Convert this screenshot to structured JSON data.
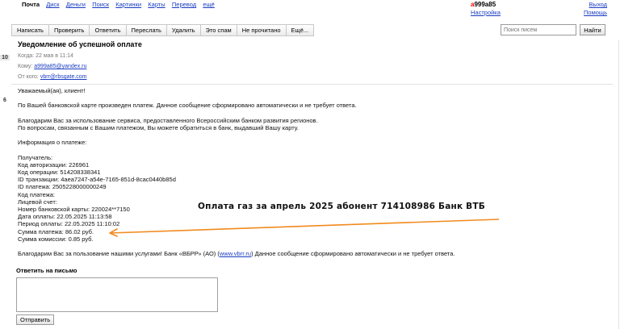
{
  "topnav": {
    "links": [
      "Почта",
      "Диск",
      "Деньги",
      "Поиск",
      "Картинки",
      "Карты",
      "Перевод",
      "ещё"
    ],
    "user_login_first": "a",
    "user_login_rest": "999a85",
    "settings": "Настройка",
    "logout": "Выход",
    "help": "Помощь"
  },
  "leftrail": {
    "date1": "10",
    "date2": "6"
  },
  "toolbar": {
    "buttons": [
      "Написать",
      "Проверить",
      "Ответить",
      "Переслать",
      "Удалить",
      "Это спам",
      "Не прочитано",
      "Ещё..."
    ],
    "search_placeholder": "Поиск писем",
    "search_button": "Найти"
  },
  "message": {
    "subject": "Уведомление об успешной оплате",
    "date_label": "Когда:",
    "date_value": "22 мая в 11:14",
    "to_label": "Кому:",
    "to_value": "a999a85@yandex.ru",
    "from_label": "От кого:",
    "from_value": "vbrr@rbsgate.com"
  },
  "body": {
    "greeting": "Уважаемый(ая), клиент!",
    "p1": "По Вашей банковской карте произведен платеж. Данное сообщение сформировано автоматически и не требует ответа.",
    "p2a": "Благодарим Вас за использование сервиса, предоставленного Всероссийским банком развития регионов.",
    "p2b": "По вопросам, связанным с Вашим платежом, Вы можете обратиться в банк, выдавший Вашу карту.",
    "info_title": "Информация о платеже:",
    "details": [
      "Получатель:",
      "Код авторизации: 226961",
      "Код операции: 514208338341",
      "ID транзакции: 4aea7247-a54e-7165-851d-8cac0440b85d",
      "ID платежа: 2505228000000249",
      "Код платежа:",
      "Лицевой счет:",
      "Номер банковской карты: 220024**7150",
      "Дата оплаты: 22.05.2025 11:13:58",
      "Период оплаты: 22.05.2025 11:10:02",
      "Сумма платежа: 86.02 руб.",
      "Сумма комиссии: 0.85 руб."
    ],
    "thanks_prefix": "Благодарим Вас за пользование нашими услугами! Банк «ВБРР» (АО) (",
    "thanks_link": "www.vbrr.ru",
    "thanks_suffix": ") Данное сообщение сформировано автоматически и не требует ответа."
  },
  "annotation": "Оплата газ за апрель 2025 абонент 714108986 Банк ВТБ",
  "reply": {
    "title": "Ответить на письмо",
    "send": "Отправить"
  },
  "colors": {
    "link": "#1a3dc1",
    "arrow": "#f28a1e",
    "login_accent": "#ff0000"
  }
}
